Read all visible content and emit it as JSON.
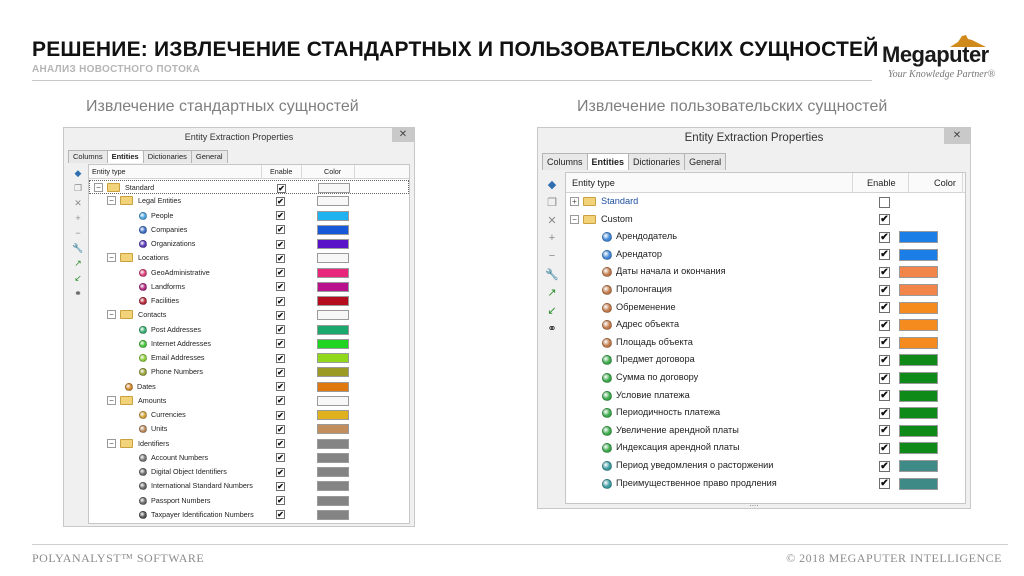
{
  "slide": {
    "title": "РЕШЕНИЕ: ИЗВЛЕЧЕНИЕ СТАНДАРТНЫХ И ПОЛЬЗОВАТЕЛЬСКИХ СУЩНОСТЕЙ",
    "subtitle": "АНАЛИЗ НОВОСТНОГО ПОТОКА"
  },
  "logo": {
    "brand": "Megaputer",
    "tagline": "Your Knowledge Partner®"
  },
  "footer": {
    "left": "POLYANALYST™ SOFTWARE",
    "right": "© 2018 MEGAPUTER INTELLIGENCE"
  },
  "left_panel": {
    "heading": "Извлечение стандартных сущностей",
    "window_title": "Entity Extraction Properties",
    "close": "✕",
    "tabs": [
      {
        "label": "Columns",
        "active": false
      },
      {
        "label": "Entities",
        "active": true
      },
      {
        "label": "Dictionaries",
        "active": false
      },
      {
        "label": "General",
        "active": false
      }
    ],
    "columns": {
      "type": "Entity type",
      "enable": "Enable",
      "color": "Color"
    },
    "rows": [
      {
        "label": "Standard",
        "kind": "folder",
        "level": 0,
        "expanded": true,
        "enabled": true,
        "color": "#f7f7f7"
      },
      {
        "label": "Legal Entities",
        "kind": "folder",
        "level": 1,
        "expanded": true,
        "enabled": true,
        "color": "#f7f7f7"
      },
      {
        "label": "People",
        "kind": "entity",
        "level": 2,
        "dot": "#4aa3df",
        "enabled": true,
        "color": "#1fb2f0"
      },
      {
        "label": "Companies",
        "kind": "entity",
        "level": 2,
        "dot": "#3d6fc4",
        "enabled": true,
        "color": "#1759d8"
      },
      {
        "label": "Organizations",
        "kind": "entity",
        "level": 2,
        "dot": "#5b3cb8",
        "enabled": true,
        "color": "#5a12c9"
      },
      {
        "label": "Locations",
        "kind": "folder",
        "level": 1,
        "expanded": true,
        "enabled": true,
        "color": "#f7f7f7"
      },
      {
        "label": "GeoAdministrative",
        "kind": "entity",
        "level": 2,
        "dot": "#d9407a",
        "enabled": true,
        "color": "#e8267b"
      },
      {
        "label": "Landforms",
        "kind": "entity",
        "level": 2,
        "dot": "#b02a82",
        "enabled": true,
        "color": "#b8138c"
      },
      {
        "label": "Facilities",
        "kind": "entity",
        "level": 2,
        "dot": "#b52a3c",
        "enabled": true,
        "color": "#b50d1d"
      },
      {
        "label": "Contacts",
        "kind": "folder",
        "level": 1,
        "expanded": true,
        "enabled": true,
        "color": "#f7f7f7"
      },
      {
        "label": "Post Addresses",
        "kind": "entity",
        "level": 2,
        "dot": "#3aae72",
        "enabled": true,
        "color": "#1aa86c"
      },
      {
        "label": "Internet Addresses",
        "kind": "entity",
        "level": 2,
        "dot": "#46c43a",
        "enabled": true,
        "color": "#21d421"
      },
      {
        "label": "Email Addresses",
        "kind": "entity",
        "level": 2,
        "dot": "#8ccf3a",
        "enabled": true,
        "color": "#8fd81c"
      },
      {
        "label": "Phone Numbers",
        "kind": "entity",
        "level": 2,
        "dot": "#9aa23a",
        "enabled": true,
        "color": "#9b9a24"
      },
      {
        "label": "Dates",
        "kind": "entity",
        "level": 1,
        "dot": "#d28a2c",
        "enabled": true,
        "color": "#e07810"
      },
      {
        "label": "Amounts",
        "kind": "folder",
        "level": 1,
        "expanded": true,
        "enabled": true,
        "color": "#f7f7f7"
      },
      {
        "label": "Currencies",
        "kind": "entity",
        "level": 2,
        "dot": "#d1a23a",
        "enabled": true,
        "color": "#e0b11f"
      },
      {
        "label": "Units",
        "kind": "entity",
        "level": 2,
        "dot": "#b98a5c",
        "enabled": true,
        "color": "#c38e5e"
      },
      {
        "label": "Identifiers",
        "kind": "folder",
        "level": 1,
        "expanded": true,
        "enabled": true,
        "color": "#848484"
      },
      {
        "label": "Account Numbers",
        "kind": "entity",
        "level": 2,
        "dot": "#777777",
        "enabled": true,
        "color": "#848484"
      },
      {
        "label": "Digital Object Identifiers",
        "kind": "entity",
        "level": 2,
        "dot": "#6b6b6b",
        "enabled": true,
        "color": "#848484"
      },
      {
        "label": "International Standard Numbers",
        "kind": "entity",
        "level": 2,
        "dot": "#6b6b6b",
        "enabled": true,
        "color": "#848484"
      },
      {
        "label": "Passport Numbers",
        "kind": "entity",
        "level": 2,
        "dot": "#6b6b6b",
        "enabled": true,
        "color": "#848484"
      },
      {
        "label": "Taxpayer Identification Numbers",
        "kind": "entity",
        "level": 2,
        "dot": "#555555",
        "enabled": true,
        "color": "#848484"
      }
    ]
  },
  "right_panel": {
    "heading": "Извлечение пользовательских сущностей",
    "window_title": "Entity Extraction Properties",
    "close": "✕",
    "tabs": [
      {
        "label": "Columns",
        "active": false
      },
      {
        "label": "Entities",
        "active": true
      },
      {
        "label": "Dictionaries",
        "active": false
      },
      {
        "label": "General",
        "active": false
      }
    ],
    "columns": {
      "type": "Entity type",
      "enable": "Enable",
      "color": "Color"
    },
    "footer_dots": "....",
    "rows": [
      {
        "label": "Standard",
        "kind": "folder",
        "level": 0,
        "expanded": false,
        "link": true,
        "enabled": false,
        "color": ""
      },
      {
        "label": "Custom",
        "kind": "folder",
        "level": 0,
        "expanded": true,
        "enabled": true,
        "color": ""
      },
      {
        "label": "Арендодатель",
        "kind": "entity",
        "level": 1,
        "dot": "#3f86d6",
        "enabled": true,
        "color": "#1b7ee6"
      },
      {
        "label": "Арендатор",
        "kind": "entity",
        "level": 1,
        "dot": "#3f86d6",
        "enabled": true,
        "color": "#1b7ee6"
      },
      {
        "label": "Даты начала и окончания",
        "kind": "entity",
        "level": 1,
        "dot": "#c07a4a",
        "enabled": true,
        "color": "#f2864a"
      },
      {
        "label": "Пролонгация",
        "kind": "entity",
        "level": 1,
        "dot": "#c07a4a",
        "enabled": true,
        "color": "#f2864a"
      },
      {
        "label": "Обременение",
        "kind": "entity",
        "level": 1,
        "dot": "#c07a4a",
        "enabled": true,
        "color": "#f58a1f"
      },
      {
        "label": "Адрес объекта",
        "kind": "entity",
        "level": 1,
        "dot": "#c07a4a",
        "enabled": true,
        "color": "#f58a1f"
      },
      {
        "label": "Площадь объекта",
        "kind": "entity",
        "level": 1,
        "dot": "#c07a4a",
        "enabled": true,
        "color": "#f58a1f"
      },
      {
        "label": "Предмет договора",
        "kind": "entity",
        "level": 1,
        "dot": "#3aa84a",
        "enabled": true,
        "color": "#0d8a18"
      },
      {
        "label": "Сумма по договору",
        "kind": "entity",
        "level": 1,
        "dot": "#3aa84a",
        "enabled": true,
        "color": "#0d8a18"
      },
      {
        "label": "Условие платежа",
        "kind": "entity",
        "level": 1,
        "dot": "#3aa84a",
        "enabled": true,
        "color": "#0d8a18"
      },
      {
        "label": "Периодичность платежа",
        "kind": "entity",
        "level": 1,
        "dot": "#3aa84a",
        "enabled": true,
        "color": "#0d8a18"
      },
      {
        "label": "Увеличение арендной платы",
        "kind": "entity",
        "level": 1,
        "dot": "#3aa84a",
        "enabled": true,
        "color": "#0d8a18"
      },
      {
        "label": "Индексация арендной платы",
        "kind": "entity",
        "level": 1,
        "dot": "#3aa84a",
        "enabled": true,
        "color": "#0d8a18"
      },
      {
        "label": "Период уведомления о расторжении",
        "kind": "entity",
        "level": 1,
        "dot": "#3a9aa0",
        "enabled": true,
        "color": "#3d8a86"
      },
      {
        "label": "Преимущественное право продления",
        "kind": "entity",
        "level": 1,
        "dot": "#3a9aa0",
        "enabled": true,
        "color": "#3d8a86"
      }
    ]
  },
  "icons": [
    "diamond-icon",
    "copy-icon",
    "delete-icon",
    "plus-icon",
    "minus-icon",
    "wrench-icon",
    "export-icon",
    "import-icon",
    "binoculars-icon",
    "folder-icon",
    "checkmark-icon",
    "close-icon"
  ]
}
